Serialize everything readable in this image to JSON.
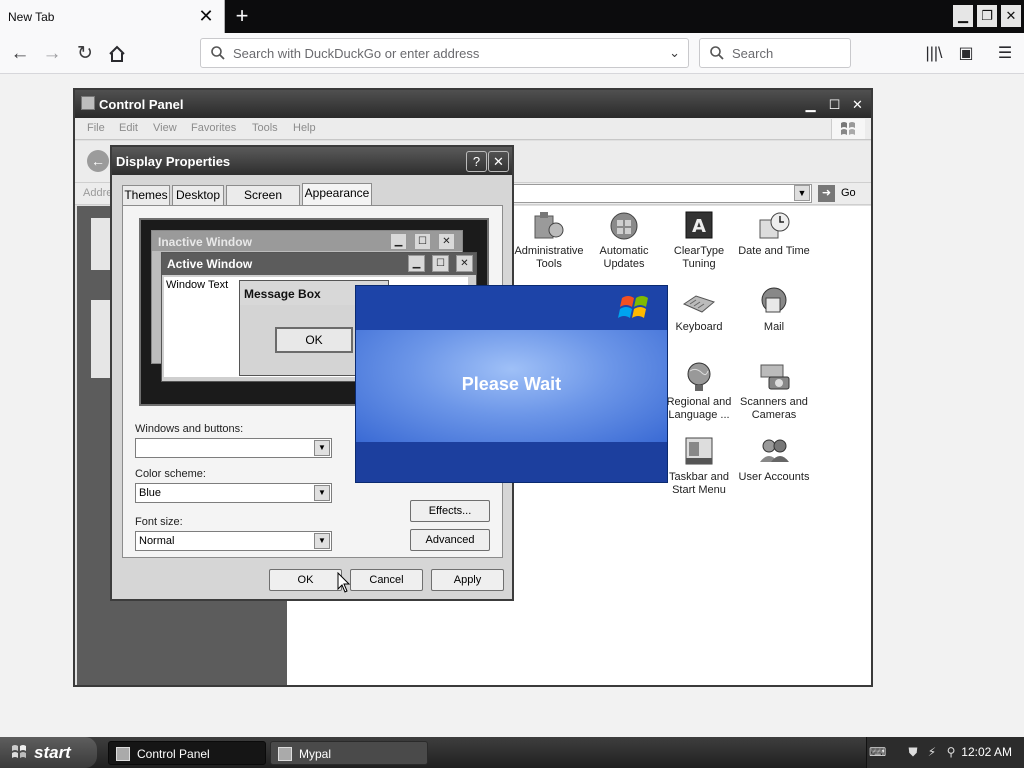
{
  "browser": {
    "tab_title": "New Tab",
    "tab_close": "✕",
    "new_tab": "+",
    "url_placeholder": "Search with DuckDuckGo or enter address",
    "search_placeholder": "Search"
  },
  "control_panel": {
    "title": "Control Panel",
    "menu": [
      "File",
      "Edit",
      "View",
      "Favorites",
      "Tools",
      "Help"
    ],
    "address_label": "Address",
    "go_label": "Go",
    "items": [
      {
        "label": "Administrative Tools",
        "icon": "administrative-tools-icon"
      },
      {
        "label": "Automatic Updates",
        "icon": "automatic-updates-icon"
      },
      {
        "label": "ClearType Tuning",
        "icon": "cleartype-icon"
      },
      {
        "label": "Date and Time",
        "icon": "date-time-icon"
      },
      {
        "label": "Keyboard",
        "icon": "keyboard-icon"
      },
      {
        "label": "Mail",
        "icon": "mail-icon"
      },
      {
        "label": "Regional and Language ...",
        "icon": "regional-language-icon"
      },
      {
        "label": "Scanners and Cameras",
        "icon": "scanners-cameras-icon"
      },
      {
        "label": "Taskbar and Start Menu",
        "icon": "taskbar-start-menu-icon"
      },
      {
        "label": "User Accounts",
        "icon": "user-accounts-icon"
      }
    ]
  },
  "display_properties": {
    "title": "Display Properties",
    "help": "?",
    "close": "✕",
    "tabs": [
      "Themes",
      "Desktop",
      "Screen Saver",
      "Appearance"
    ],
    "active_tab": "Appearance",
    "preview": {
      "inactive_title": "Inactive Window",
      "active_title": "Active Window",
      "window_text": "Window Text",
      "message_box_title": "Message Box",
      "message_box_ok": "OK"
    },
    "windows_buttons_label": "Windows and buttons:",
    "windows_buttons_value": "",
    "color_scheme_label": "Color scheme:",
    "color_scheme_value": "Blue",
    "font_size_label": "Font size:",
    "font_size_value": "Normal",
    "effects_button": "Effects...",
    "advanced_button": "Advanced",
    "ok_button": "OK",
    "cancel_button": "Cancel",
    "apply_button": "Apply"
  },
  "please_wait": {
    "text": "Please Wait"
  },
  "taskbar": {
    "start_label": "start",
    "tasks": [
      "Control Panel",
      "Mypal"
    ],
    "clock": "12:02 AM"
  },
  "colors": {
    "xp_blue": "#1e4aa8",
    "browser_tabbar": "#0c0c0d"
  }
}
